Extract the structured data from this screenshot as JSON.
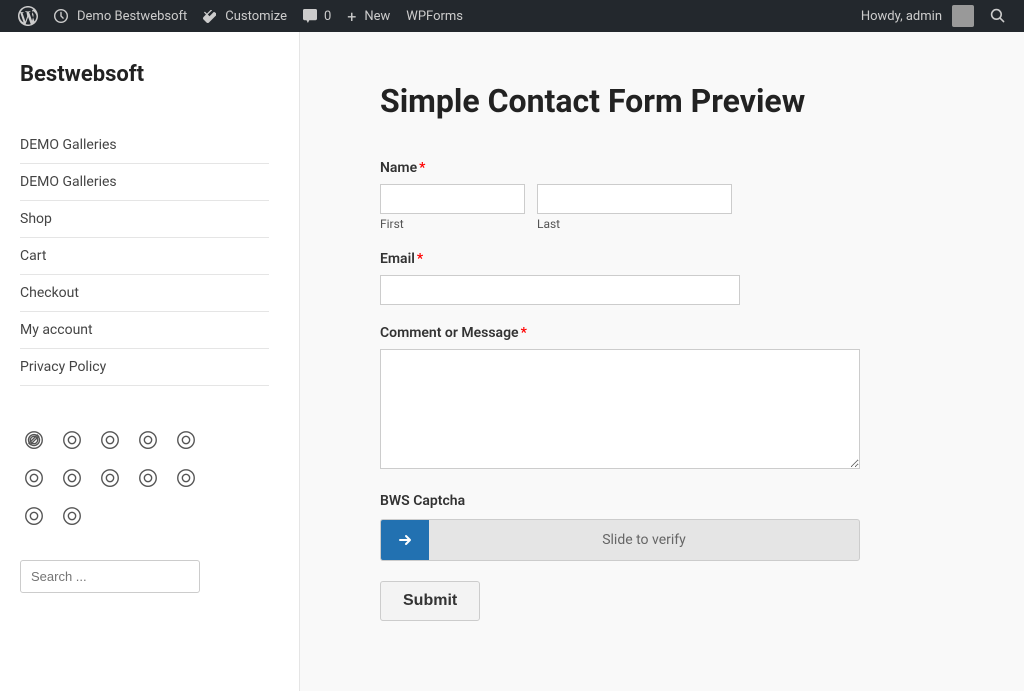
{
  "adminBar": {
    "items": [
      {
        "label": "",
        "type": "wp-logo"
      },
      {
        "label": "Demo Bestwebsoft",
        "type": "site-name"
      },
      {
        "label": "Customize",
        "type": "customize"
      },
      {
        "label": "0",
        "type": "comments"
      },
      {
        "label": "New",
        "type": "new"
      },
      {
        "label": "WPForms",
        "type": "wpforms"
      }
    ],
    "right": {
      "howdy": "Howdy, admin",
      "searchLabel": "Search"
    }
  },
  "sidebar": {
    "logo": "Bestwebsoft",
    "nav": [
      {
        "label": "DEMO Galleries"
      },
      {
        "label": "DEMO Galleries"
      },
      {
        "label": "Shop"
      },
      {
        "label": "Cart"
      },
      {
        "label": "Checkout"
      },
      {
        "label": "My account"
      },
      {
        "label": "Privacy Policy"
      }
    ],
    "search": {
      "placeholder": "Search ..."
    }
  },
  "main": {
    "title": "Simple Contact Form Preview",
    "form": {
      "nameLabelText": "Name",
      "firstFieldHint": "First",
      "lastFieldHint": "Last",
      "emailLabelText": "Email",
      "messageLabelText": "Comment or Message",
      "captchaLabel": "BWS Captcha",
      "captchaSliderText": "Slide to verify",
      "submitLabel": "Submit"
    }
  }
}
